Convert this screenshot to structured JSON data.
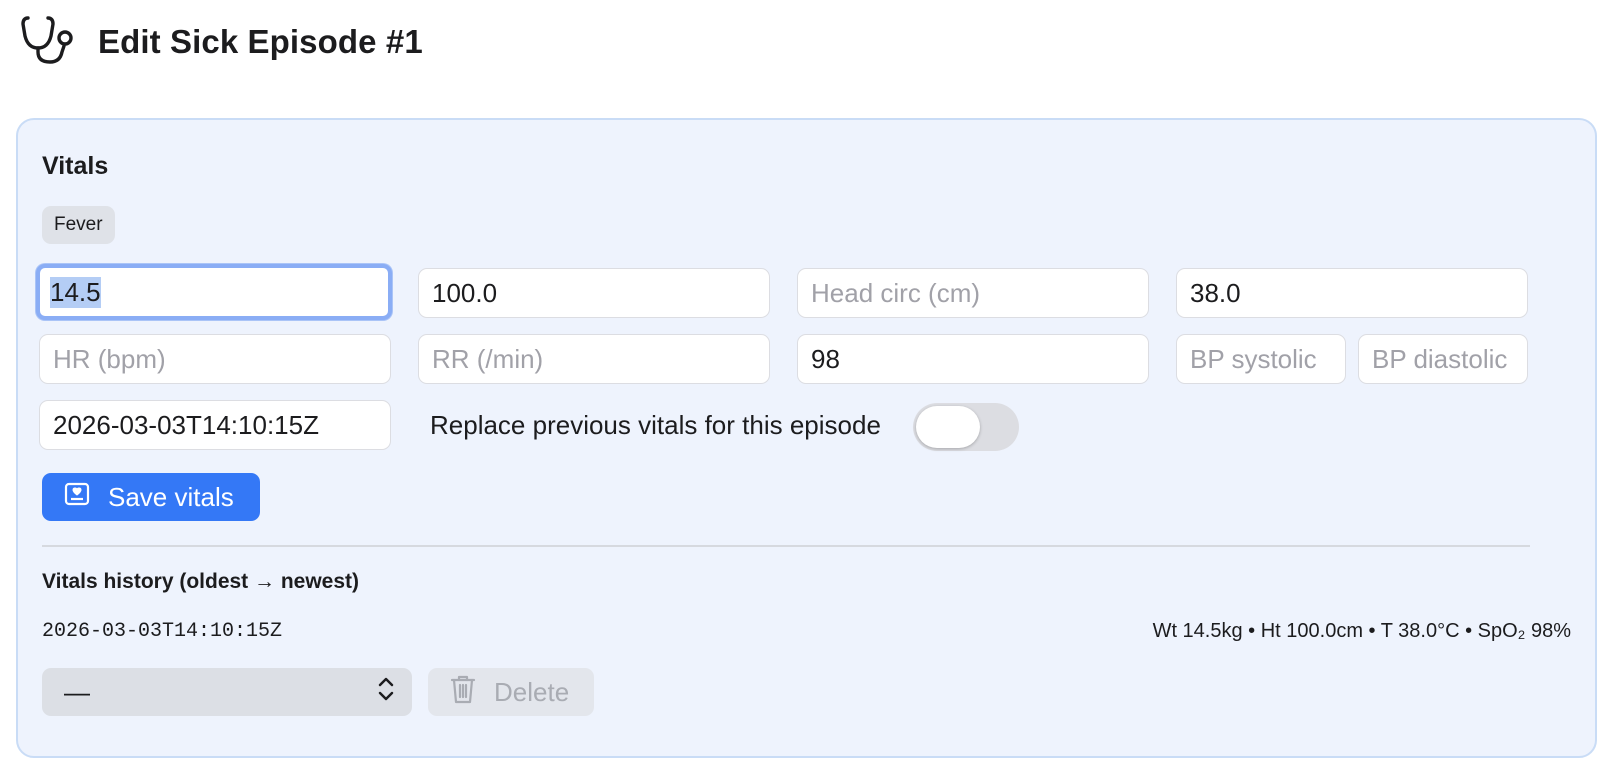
{
  "header": {
    "title": "Edit Sick Episode #1",
    "icon": "stethoscope-icon"
  },
  "vitals": {
    "section_title": "Vitals",
    "tag": "Fever",
    "fields": {
      "weight": {
        "value": "14.5",
        "placeholder": ""
      },
      "height": {
        "value": "100.0",
        "placeholder": ""
      },
      "head_circ": {
        "value": "",
        "placeholder": "Head circ (cm)"
      },
      "temperature": {
        "value": "38.0",
        "placeholder": ""
      },
      "hr": {
        "value": "",
        "placeholder": "HR (bpm)"
      },
      "rr": {
        "value": "",
        "placeholder": "RR (/min)"
      },
      "spo2": {
        "value": "98",
        "placeholder": ""
      },
      "bp_systolic": {
        "value": "",
        "placeholder": "BP systolic"
      },
      "bp_diastolic": {
        "value": "",
        "placeholder": "BP diastolic"
      },
      "timestamp": {
        "value": "2026-03-03T14:10:15Z",
        "placeholder": ""
      }
    },
    "replace_toggle": {
      "label": "Replace previous vitals for this episode",
      "on": false
    },
    "save_button": {
      "label": "Save vitals",
      "icon": "vitals-card-icon"
    }
  },
  "history": {
    "title": "Vitals history (oldest → newest)",
    "entries": [
      {
        "time": "2026-03-03T14:10:15Z",
        "summary": "Wt 14.5kg • Ht 100.0cm • T 38.0°C • SpO₂ 98%"
      }
    ],
    "select": {
      "selected": "—"
    },
    "delete_button": {
      "label": "Delete",
      "icon": "trash-icon"
    }
  },
  "colors": {
    "accent": "#3478f6",
    "card_bg": "#eef3fd",
    "card_border": "#c9dcf6"
  }
}
